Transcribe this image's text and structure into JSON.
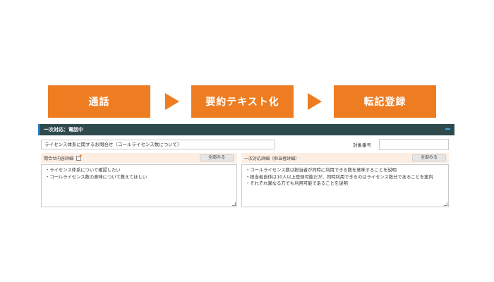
{
  "flow": {
    "steps": [
      "通話",
      "要約テキスト化",
      "転記登録"
    ]
  },
  "panel": {
    "title": "一次対応：電話中",
    "subject_value": "ライセンス体系に関するお問合せ（コールライセンス数について）",
    "target_label": "対象番号",
    "target_value": "",
    "inquiry": {
      "label": "問合せ内容詳細",
      "show_all": "全部みる",
      "lines": [
        "・ライセンス体系について確認したい",
        "・コールライセンス数の意味について教えてほしい"
      ]
    },
    "response": {
      "label": "一次対応詳細（担当者詳細）",
      "show_all": "全部みる",
      "lines": [
        "・コールライセンス数は担当者が同時に利用できる数を意味することを説明",
        "・担当者自体は10人以上登録可能だが、同時利用できるのはライセンス数分であることを案内",
        "・それぞれ異なる方でも利用可能であることを説明"
      ]
    }
  },
  "colors": {
    "accent_orange": "#ee7d22",
    "header_bg": "#2f4a4c",
    "section_bg": "#fdeee4"
  }
}
